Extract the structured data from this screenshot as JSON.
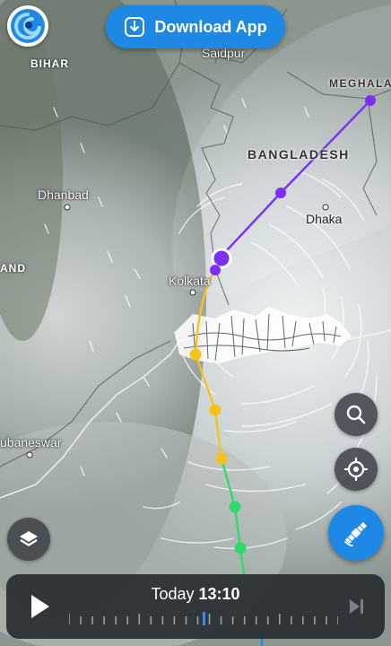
{
  "header": {
    "download_label": "Download App"
  },
  "map": {
    "labels": {
      "bihar": "BIHAR",
      "saidpur": "Saidpur",
      "meghalaya": "MEGHALA",
      "bangladesh": "BANGLADESH",
      "dhanbad": "Dhanbad",
      "dhaka": "Dhaka",
      "kolkata": "Kolkata",
      "land": "AND",
      "bhubaneswar": "ubaneswar"
    }
  },
  "track": {
    "colors": {
      "purple": "#7b2ff7",
      "yellow": "#f7c21b",
      "green": "#2edb6a",
      "blue": "#1e88e5"
    }
  },
  "controls": {
    "icons": [
      "app-logo-icon",
      "download-icon",
      "search-icon",
      "locate-icon",
      "layers-icon",
      "satellite-icon",
      "play-icon",
      "skip-end-icon"
    ]
  },
  "timeline": {
    "day": "Today",
    "time": "13:10",
    "progress": 0.5
  }
}
